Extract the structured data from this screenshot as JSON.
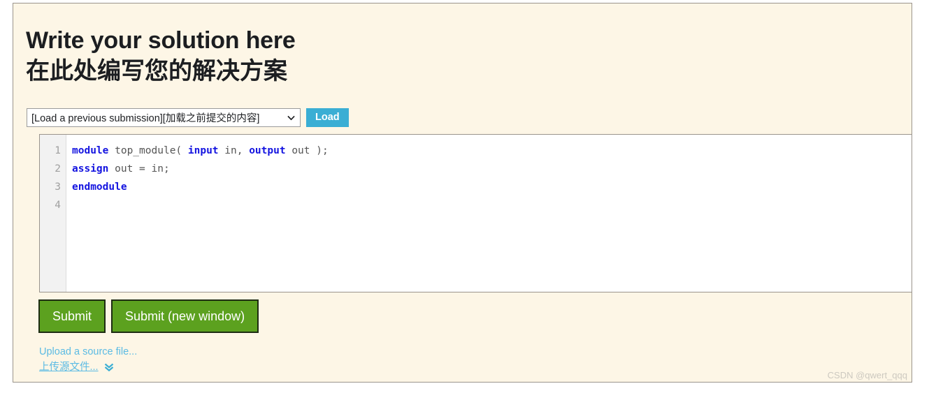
{
  "heading": {
    "line_en": "Write your solution here",
    "line_zh": "在此处编写您的解决方案"
  },
  "load_row": {
    "select_value": "[Load a previous submission][加载之前提交的内容]",
    "select_options": [
      "[Load a previous submission][加载之前提交的内容]"
    ],
    "chevron_icon": "chevron-down-icon",
    "load_label": "Load",
    "load_color": "#3aaed4"
  },
  "editor": {
    "line_numbers": [
      "1",
      "2",
      "3",
      "4"
    ],
    "lines": [
      [
        {
          "t": "module",
          "k": true
        },
        {
          "t": " top_module( ",
          "k": false
        },
        {
          "t": "input",
          "k": true
        },
        {
          "t": " in, ",
          "k": false
        },
        {
          "t": "output",
          "k": true
        },
        {
          "t": " out );",
          "k": false
        }
      ],
      [
        {
          "t": "assign",
          "k": true
        },
        {
          "t": " out = in;",
          "k": false
        }
      ],
      [
        {
          "t": "endmodule",
          "k": true
        }
      ],
      []
    ],
    "keyword_color": "#1414e0",
    "text_color": "#555555"
  },
  "buttons": {
    "submit_label": "Submit",
    "submit_new_window_label": "Submit (new window)",
    "green": "#5ca11f"
  },
  "upload": {
    "link_en": "Upload a source file...",
    "link_zh": "上传源文件...",
    "expand_icon": "double-chevron-down-icon",
    "link_color": "#5bbbe4"
  },
  "watermark": {
    "text": "CSDN @qwert_qqq"
  },
  "theme": {
    "page_background": "#fdf6e6",
    "border": "#9a948c"
  }
}
